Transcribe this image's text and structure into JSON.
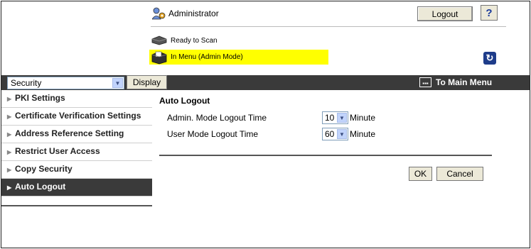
{
  "header": {
    "user_label": "Administrator",
    "logout_label": "Logout",
    "help_label": "?"
  },
  "status": {
    "ready_label": "Ready to Scan",
    "menu_label": "In Menu (Admin Mode)",
    "highlight_color": "#ffff00"
  },
  "toolbar": {
    "category_value": "Security",
    "display_label": "Display",
    "main_menu_label": "To Main Menu",
    "background_color": "#3a3a3a"
  },
  "sidebar": {
    "items": [
      {
        "label": "PKI Settings",
        "active": false
      },
      {
        "label": "Certificate Verification Settings",
        "active": false
      },
      {
        "label": "Address Reference Setting",
        "active": false
      },
      {
        "label": "Restrict User Access",
        "active": false
      },
      {
        "label": "Copy Security",
        "active": false
      },
      {
        "label": "Auto Logout",
        "active": true
      }
    ]
  },
  "main": {
    "title": "Auto Logout",
    "admin_row": {
      "label": "Admin. Mode Logout Time",
      "value": "10",
      "unit": "Minute"
    },
    "user_row": {
      "label": "User Mode Logout Time",
      "value": "60",
      "unit": "Minute"
    },
    "ok_label": "OK",
    "cancel_label": "Cancel"
  },
  "icons": {
    "admin": "admin-user-icon",
    "scanner": "scanner-icon",
    "menu_printer": "printer-icon",
    "refresh": "refresh-icon",
    "main_menu": "main-menu-icon",
    "dropdown": "chevron-down-icon",
    "arrow": "triangle-right-icon"
  }
}
